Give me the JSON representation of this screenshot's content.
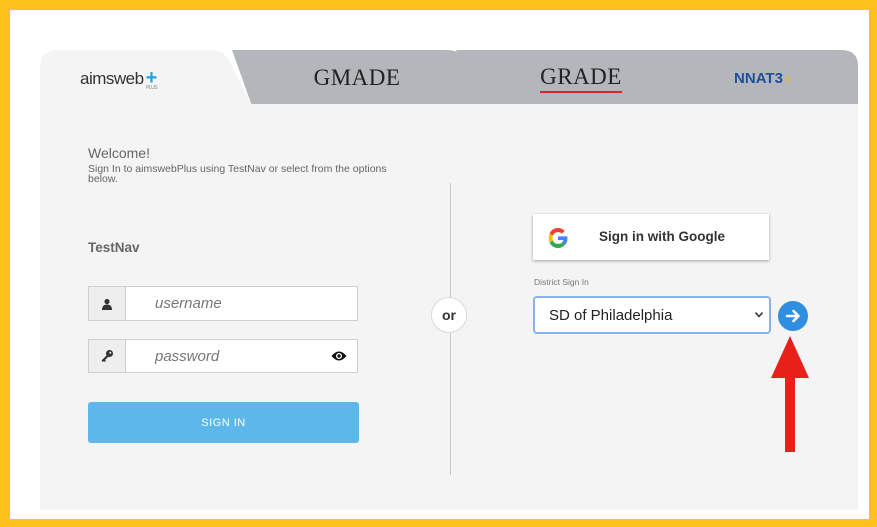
{
  "tabs": [
    {
      "label": "aimsweb",
      "sub": "PLUS"
    },
    {
      "label": "GMADE"
    },
    {
      "label": "GRADE"
    },
    {
      "label": "NNAT3"
    }
  ],
  "welcome": {
    "title": "Welcome!",
    "subtitle": "Sign In to aimswebPlus using TestNav or select from the options below."
  },
  "testnav": {
    "heading": "TestNav",
    "username_placeholder": "username",
    "password_placeholder": "password",
    "signin_label": "SIGN IN"
  },
  "divider_text": "or",
  "google": {
    "label": "Sign in with Google"
  },
  "district": {
    "label": "District Sign In",
    "selected": "SD of Philadelphia"
  },
  "colors": {
    "frame": "#FCC21B",
    "signin_button": "#5CB7EA",
    "go_button": "#2F8EE0",
    "annotation_arrow": "#E8201A"
  }
}
